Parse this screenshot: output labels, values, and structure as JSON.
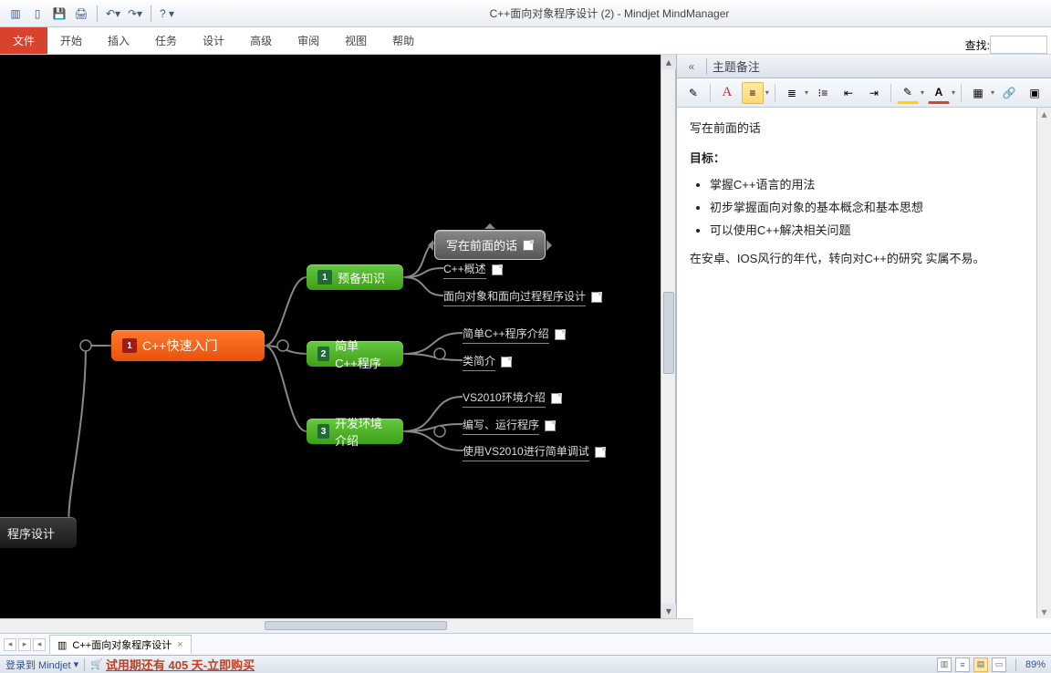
{
  "title": "C++面向对象程序设计 (2) - Mindjet MindManager",
  "ribbon": {
    "file": "文件",
    "tabs": [
      "开始",
      "插入",
      "任务",
      "设计",
      "高级",
      "审阅",
      "视图",
      "帮助"
    ],
    "find_label": "查找:"
  },
  "canvas": {
    "root": {
      "num": "1",
      "label": "C++快速入门"
    },
    "parent_cut": "程序设计",
    "branches": [
      {
        "num": "1",
        "label": "预备知识",
        "selected_leaf": "写在前面的话",
        "leaves": [
          "C++概述",
          "面向对象和面向过程程序设计"
        ]
      },
      {
        "num": "2",
        "label": "简单C++程序",
        "leaves": [
          "简单C++程序介绍",
          "类简介"
        ]
      },
      {
        "num": "3",
        "label": "开发环境介绍",
        "leaves": [
          "VS2010环境介绍",
          "编写、运行程序",
          "使用VS2010进行简单调试"
        ]
      }
    ]
  },
  "notes": {
    "panel_title": "主题备注",
    "first_line": "写在前面的话",
    "heading": "目标：",
    "bullets": [
      "掌握C++语言的用法",
      "初步掌握面向对象的基本概念和基本思想",
      "可以使用C++解决相关问题"
    ],
    "paragraph": "在安卓、IOS风行的年代，转向对C++的研究 实属不易。"
  },
  "doc_tab": "C++面向对象程序设计",
  "status": {
    "login": "登录到 Mindjet",
    "trial": "试用期还有 405 天-立即购买",
    "zoom": "89%"
  }
}
